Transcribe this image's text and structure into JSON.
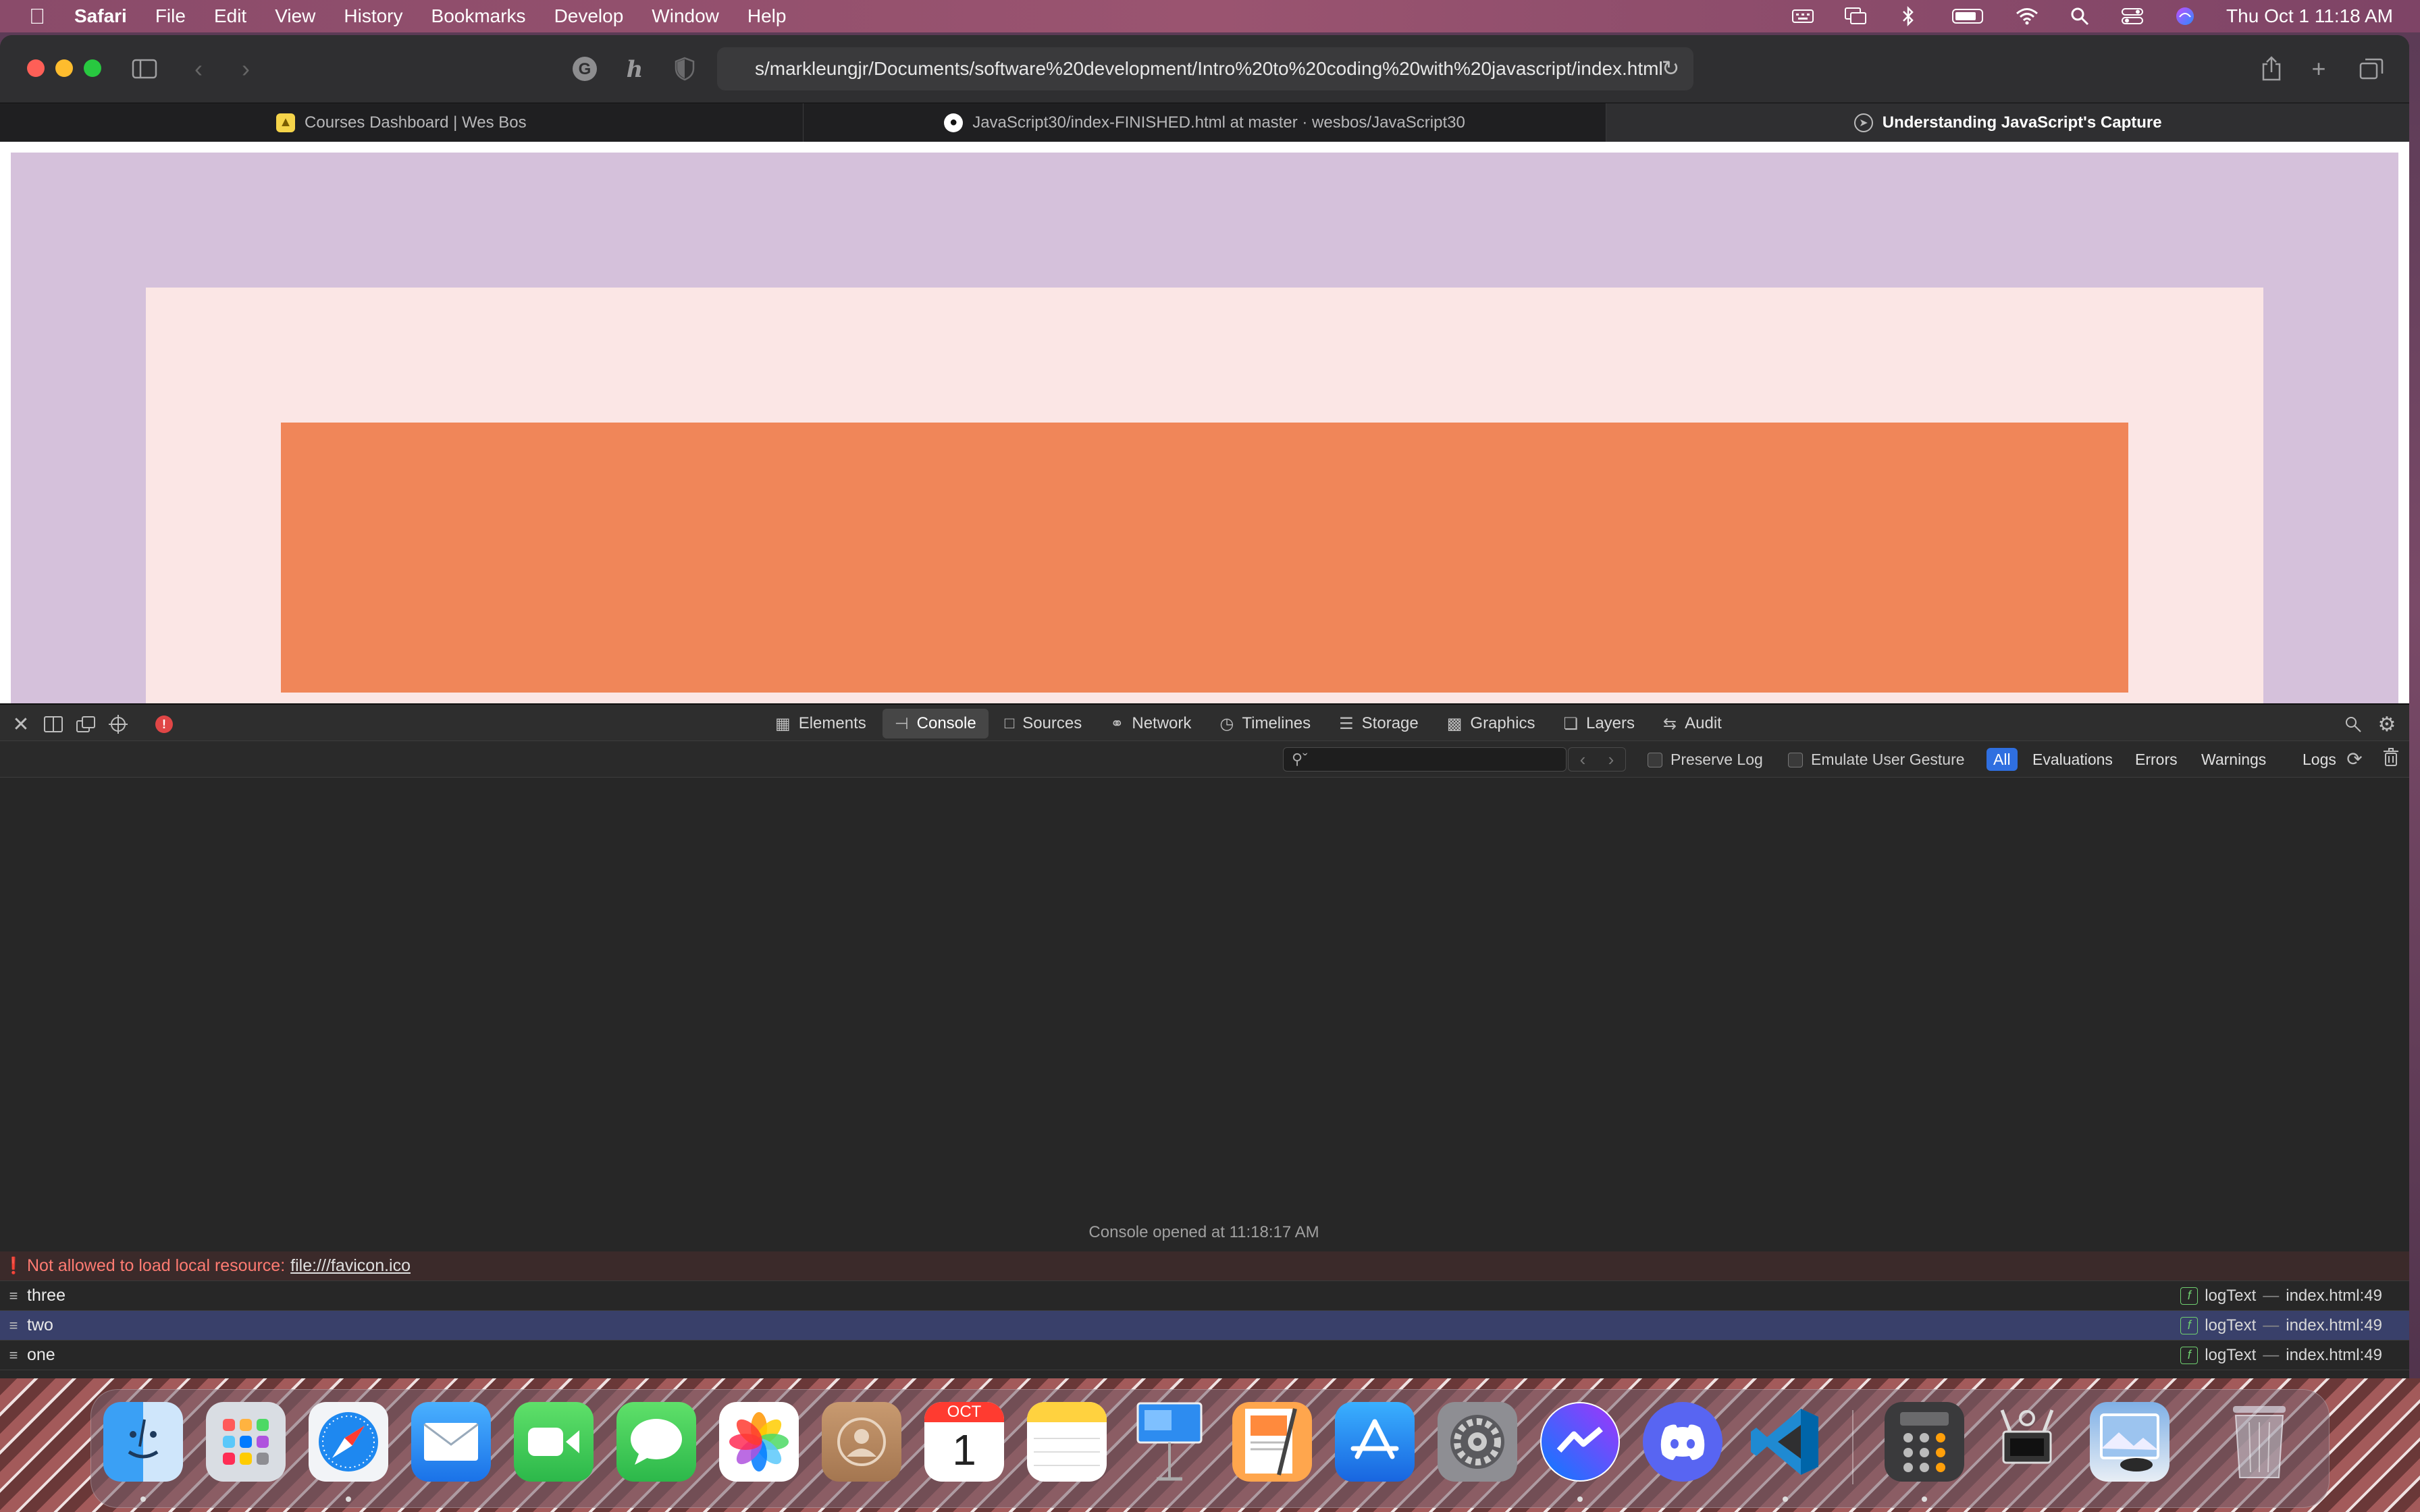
{
  "menubar": {
    "app": "Safari",
    "items": [
      "File",
      "Edit",
      "View",
      "History",
      "Bookmarks",
      "Develop",
      "Window",
      "Help"
    ],
    "clock": "Thu Oct 1  11:18 AM"
  },
  "browser": {
    "url": "s/markleungjr/Documents/software%20development/Intro%20to%20coding%20with%20javascript/index.html",
    "tabs": [
      {
        "title": "Courses Dashboard | Wes Bos"
      },
      {
        "title": "JavaScript30/index-FINISHED.html at master · wesbos/JavaScript30"
      },
      {
        "title": "Understanding JavaScript's Capture"
      }
    ]
  },
  "page": {
    "colors": {
      "outer": "#d5c1db",
      "middle": "#fbe6e5",
      "inner": "#f08659"
    }
  },
  "inspector": {
    "tabs": [
      "Elements",
      "Console",
      "Sources",
      "Network",
      "Timelines",
      "Storage",
      "Graphics",
      "Layers",
      "Audit"
    ],
    "active_tab": "Console",
    "filter_placeholder": "",
    "preserve_log": "Preserve Log",
    "emulate_gesture": "Emulate User Gesture",
    "levels": [
      "All",
      "Evaluations",
      "Errors",
      "Warnings",
      "Logs"
    ],
    "console_opened": "Console opened at 11:18:17 AM",
    "error_message": "Not allowed to load local resource:",
    "error_link": "file:///favicon.ico",
    "logs": [
      {
        "text": "three",
        "func": "logText",
        "source": "index.html:49"
      },
      {
        "text": "two",
        "func": "logText",
        "source": "index.html:49"
      },
      {
        "text": "one",
        "func": "logText",
        "source": "index.html:49"
      }
    ]
  },
  "dock": {
    "calendar_month": "OCT",
    "calendar_day": "1"
  }
}
